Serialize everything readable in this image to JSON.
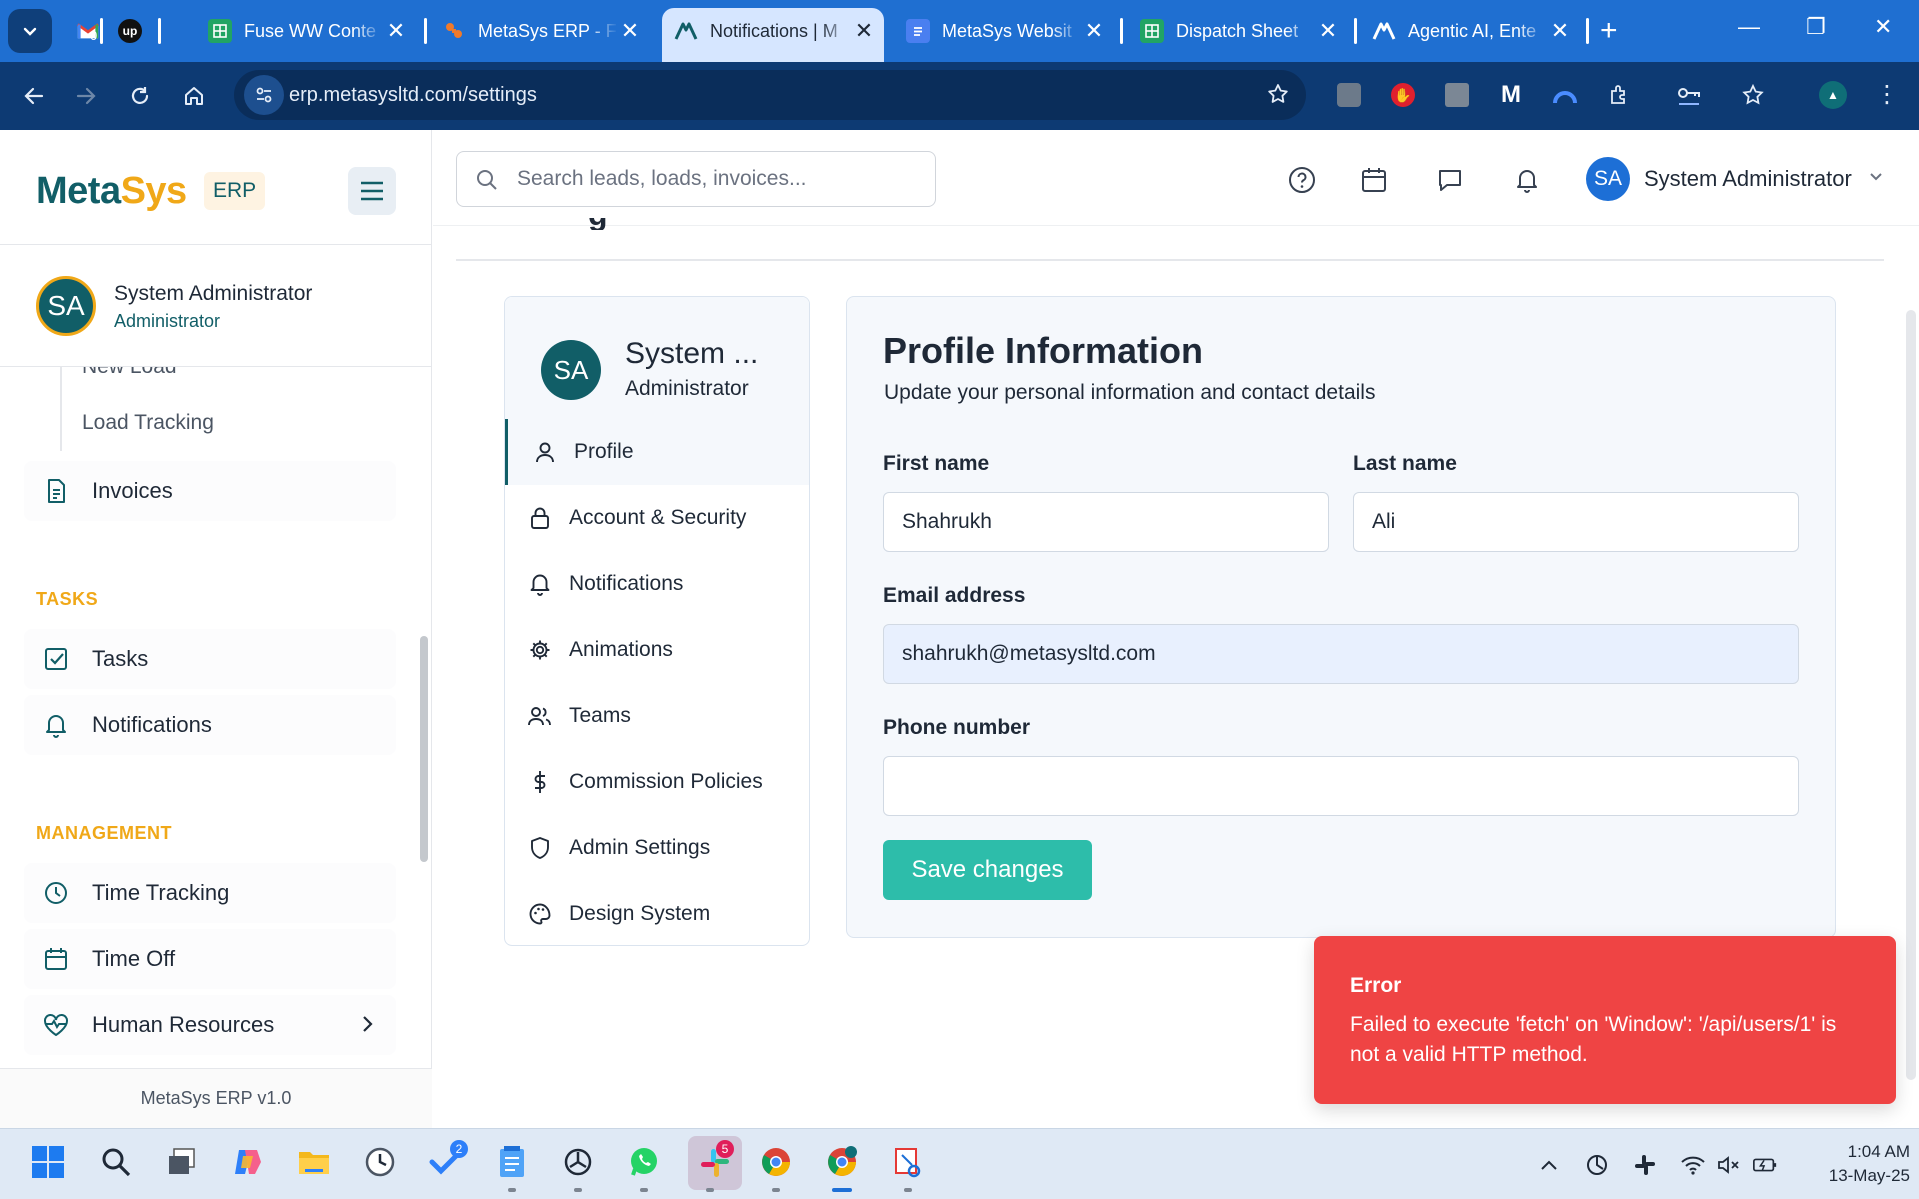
{
  "browser": {
    "tabs": [
      {
        "label": "",
        "favicon": "gmail-icon"
      },
      {
        "label": "",
        "favicon": "upwork-icon"
      },
      {
        "label": "Fuse WW Conte",
        "favicon": "sheets-icon"
      },
      {
        "label": "MetaSys ERP - F",
        "favicon": "metasys-icon"
      },
      {
        "label": "Notifications | M",
        "favicon": "app-icon",
        "active": true
      },
      {
        "label": "MetaSys Websit",
        "favicon": "docs-icon"
      },
      {
        "label": "Dispatch Sheet",
        "favicon": "sheets-icon"
      },
      {
        "label": "Agentic AI, Ente",
        "favicon": "app-icon"
      }
    ],
    "gmail_count": "0",
    "url": "erp.metasysltd.com/settings"
  },
  "sidebar": {
    "logo_meta": "Meta",
    "logo_sys": "Sys",
    "erp_badge": "ERP",
    "user": {
      "initials": "SA",
      "name": "System Administrator",
      "role": "Administrator"
    },
    "subitems": [
      "New Load",
      "Load Tracking"
    ],
    "items_top": [
      {
        "label": "Invoices",
        "icon": "file-text-icon"
      }
    ],
    "sections": [
      {
        "title": "TASKS",
        "items": [
          {
            "label": "Tasks",
            "icon": "check-square-icon"
          },
          {
            "label": "Notifications",
            "icon": "bell-icon"
          }
        ]
      },
      {
        "title": "MANAGEMENT",
        "items": [
          {
            "label": "Time Tracking",
            "icon": "clock-icon"
          },
          {
            "label": "Time Off",
            "icon": "calendar-icon"
          },
          {
            "label": "Human Resources",
            "icon": "heart-pulse-icon"
          }
        ]
      }
    ],
    "footer": "MetaSys ERP v1.0"
  },
  "header": {
    "search_placeholder": "Search leads, loads, invoices...",
    "user_initials": "SA",
    "user_name": "System Administrator"
  },
  "settings_nav": {
    "user_initials": "SA",
    "user_name": "System ...",
    "user_role": "Administrator",
    "items": [
      {
        "label": "Profile",
        "icon": "user-icon",
        "active": true
      },
      {
        "label": "Account & Security",
        "icon": "lock-icon"
      },
      {
        "label": "Notifications",
        "icon": "bell-icon"
      },
      {
        "label": "Animations",
        "icon": "gear-icon"
      },
      {
        "label": "Teams",
        "icon": "users-icon"
      },
      {
        "label": "Commission Policies",
        "icon": "dollar-icon"
      },
      {
        "label": "Admin Settings",
        "icon": "shield-icon"
      },
      {
        "label": "Design System",
        "icon": "palette-icon"
      }
    ]
  },
  "profile": {
    "title": "Profile Information",
    "subtitle": "Update your personal information and contact details",
    "first_name_label": "First name",
    "first_name_value": "Shahrukh",
    "last_name_label": "Last name",
    "last_name_value": "Ali",
    "email_label": "Email address",
    "email_value": "shahrukh@metasysltd.com",
    "phone_label": "Phone number",
    "phone_value": "",
    "save_label": "Save changes"
  },
  "toast": {
    "title": "Error",
    "message": "Failed to execute 'fetch' on 'Window': '/api/users/1' is not a valid HTTP method."
  },
  "taskbar": {
    "todo_badge": "2",
    "slack_badge": "5",
    "time": "1:04 AM",
    "date": "13-May-25"
  },
  "colors": {
    "brand_teal": "#115e67",
    "brand_orange": "#f0a818",
    "save_button": "#2dbdaa",
    "error_toast": "#ef4444",
    "tab_bar": "#1f6fd1"
  }
}
